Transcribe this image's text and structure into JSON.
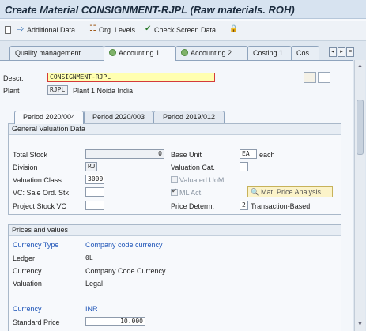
{
  "window": {
    "title": "Create Material CONSIGNMENT-RJPL (Raw materials. ROH)"
  },
  "toolbar": {
    "additional_data": "Additional Data",
    "org_levels": "Org. Levels",
    "check_screen_data": "Check Screen Data"
  },
  "tabs": [
    {
      "label": "Quality management",
      "status": false
    },
    {
      "label": "Accounting 1",
      "status": true
    },
    {
      "label": "Accounting 2",
      "status": true
    },
    {
      "label": "Costing 1",
      "status": false
    },
    {
      "label": "Cos...",
      "status": false
    }
  ],
  "header": {
    "descr_label": "Descr.",
    "descr_value": "CONSIGNMENT-RJPL",
    "plant_label": "Plant",
    "plant_code": "RJPL",
    "plant_name": "Plant 1 Noida India"
  },
  "period_tabs": [
    {
      "label": "Period 2020/004"
    },
    {
      "label": "Period 2020/003"
    },
    {
      "label": "Period 2019/012"
    }
  ],
  "general": {
    "title": "General Valuation Data",
    "total_stock_label": "Total Stock",
    "total_stock_value": "0",
    "base_unit_label": "Base Unit",
    "base_unit_value": "EA",
    "base_unit_text": "each",
    "division_label": "Division",
    "division_value": "RJ",
    "valuation_cat_label": "Valuation Cat.",
    "valuation_cat_value": "",
    "valuation_class_label": "Valuation Class",
    "valuation_class_value": "3000",
    "valuated_uom_label": "Valuated UoM",
    "vc_sale_label": "VC: Sale Ord. Stk",
    "vc_sale_value": "",
    "ml_act_label": "ML Act.",
    "mat_price_btn": "Mat. Price Analysis",
    "project_stock_label": "Project Stock VC",
    "project_stock_value": "",
    "price_determ_label": "Price Determ.",
    "price_determ_value": "2",
    "price_determ_text": "Transaction-Based"
  },
  "prices": {
    "title": "Prices and values",
    "currency_type_label": "Currency Type",
    "currency_type_value": "Company code currency",
    "ledger_label": "Ledger",
    "ledger_value": "0L",
    "currency_label": "Currency",
    "currency_value": "Company Code Currency",
    "valuation_label": "Valuation",
    "valuation_value": "Legal",
    "currency2_label": "Currency",
    "currency2_value": "INR",
    "standard_price_label": "Standard Price",
    "standard_price_value": "10.000"
  }
}
